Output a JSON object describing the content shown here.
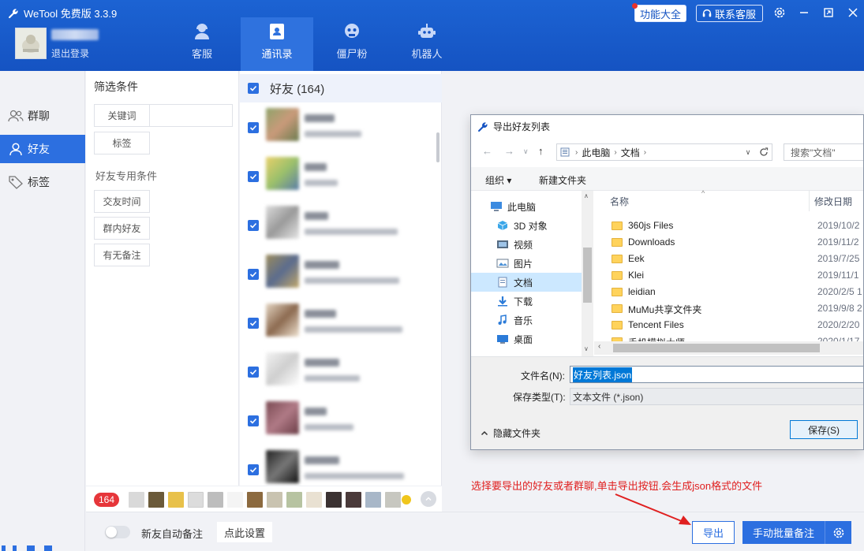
{
  "app": {
    "title": "WeTool 免费版 3.3.9",
    "logout": "退出登录",
    "features_label": "功能大全",
    "contact_label": "联系客服",
    "nav_tabs": [
      {
        "label": "客服",
        "icon": "headset-icon"
      },
      {
        "label": "通讯录",
        "icon": "contacts-icon",
        "active": true
      },
      {
        "label": "僵尸粉",
        "icon": "zombie-icon"
      },
      {
        "label": "机器人",
        "icon": "robot-icon"
      }
    ]
  },
  "leftnav": {
    "items": [
      {
        "label": "群聊",
        "icon": "group-icon"
      },
      {
        "label": "好友",
        "icon": "person-icon",
        "active": true
      },
      {
        "label": "标签",
        "icon": "tag-icon"
      }
    ]
  },
  "filter": {
    "title": "筛选条件",
    "keyword_label": "关键词",
    "keyword_value": "",
    "tag_label": "标签",
    "friend_conditions_title": "好友专用条件",
    "buttons": [
      "交友时间",
      "群内好友",
      "有无备注"
    ]
  },
  "friends": {
    "header_label": "好友",
    "header_count": "(164)",
    "selected_count": "164"
  },
  "bottom": {
    "auto_remark_label": "新友自动备注",
    "settings_label": "点此设置",
    "export_label": "导出",
    "batch_remark_label": "手动批量备注",
    "annotation": "选择要导出的好友或者群聊,单击导出按钮.会生成json格式的文件"
  },
  "dialog": {
    "title": "导出好友列表",
    "breadcrumb": [
      "此电脑",
      "文档"
    ],
    "search_placeholder": "搜索\"文档\"",
    "organize_label": "组织 ▾",
    "new_folder_label": "新建文件夹",
    "tree": [
      {
        "label": "此电脑",
        "icon": "pc-icon"
      },
      {
        "label": "3D 对象",
        "icon": "cube-icon"
      },
      {
        "label": "视频",
        "icon": "video-icon"
      },
      {
        "label": "图片",
        "icon": "picture-icon"
      },
      {
        "label": "文档",
        "icon": "document-icon",
        "active": true
      },
      {
        "label": "下载",
        "icon": "download-icon"
      },
      {
        "label": "音乐",
        "icon": "music-icon"
      },
      {
        "label": "桌面",
        "icon": "desktop-icon"
      }
    ],
    "columns": {
      "name": "名称",
      "date": "修改日期"
    },
    "files": [
      {
        "name": "360js Files",
        "date": "2019/10/2"
      },
      {
        "name": "Downloads",
        "date": "2019/11/2"
      },
      {
        "name": "Eek",
        "date": "2019/7/25"
      },
      {
        "name": "Klei",
        "date": "2019/11/1"
      },
      {
        "name": "leidian",
        "date": "2020/2/5 1"
      },
      {
        "name": "MuMu共享文件夹",
        "date": "2019/9/8 2"
      },
      {
        "name": "Tencent Files",
        "date": "2020/2/20"
      },
      {
        "name": "手机模拟大师",
        "date": "2020/1/17"
      }
    ],
    "filename_label": "文件名(N):",
    "filename_value": "好友列表.json",
    "filetype_label": "保存类型(T):",
    "filetype_value": "文本文件 (*.json)",
    "hide_folders_label": "隐藏文件夹",
    "save_label": "保存(S)"
  },
  "colors": {
    "brand": "#1553c2",
    "accent": "#2c6fe0",
    "badge": "#e6363a",
    "annotation": "#e02020"
  }
}
